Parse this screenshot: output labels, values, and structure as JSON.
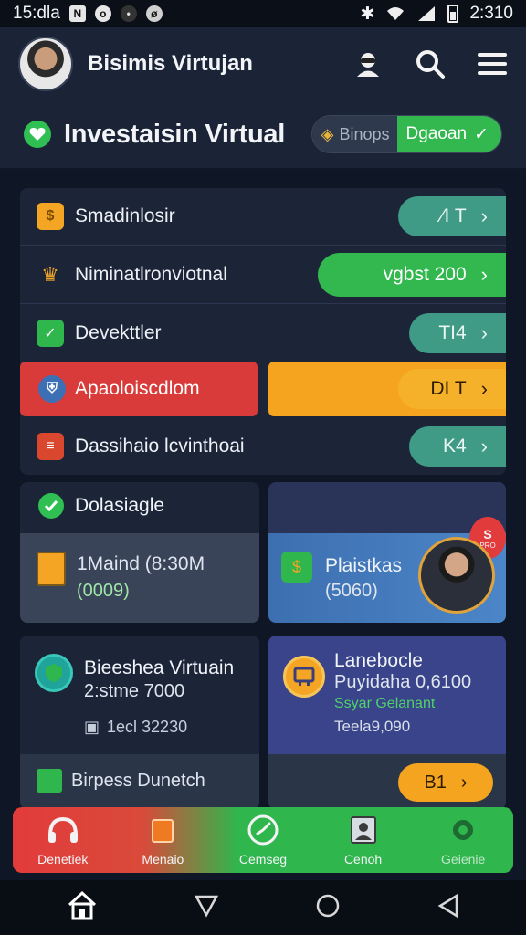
{
  "status_bar": {
    "time_left": "15:dla",
    "time_right": "2:310"
  },
  "header": {
    "title": "Bisimis Virtujan"
  },
  "section": {
    "title": "Investaisin Virtual",
    "toggle_inactive": "Binops",
    "toggle_active": "Dgaoan"
  },
  "list": {
    "items": [
      {
        "label": "Smadinlosir",
        "value": "⁄I T"
      },
      {
        "label": "Niminatlronviotnal",
        "value": "vgbst 200"
      },
      {
        "label": "Devekttler",
        "value": "TI4"
      },
      {
        "label": "Apaoloiscdlom",
        "value": "DI T"
      },
      {
        "label": "Dassihaio lcvinthoai",
        "value": "K4"
      }
    ]
  },
  "cards": {
    "card1": {
      "title": "Dolasiagle",
      "subtitle": "1Maind (8:30M",
      "value": "(0009)"
    },
    "card2": {
      "badge": "S",
      "badge_sub": "PRO",
      "title": "Plaistkas",
      "value": "(5060)"
    },
    "card3": {
      "title": "Bieeshea Virtuain",
      "subtitle": "2:stme 7000",
      "detail": "1ecl 32230",
      "footer": "Birpess Dunetch"
    },
    "card4": {
      "title": "Lanebocle",
      "subtitle": "Puyidaha 0,6100",
      "note": "Ssyar Gelanant",
      "detail": "Teela9,090",
      "button": "B1"
    }
  },
  "bottom_nav": {
    "items": [
      {
        "label": "Denetiek"
      },
      {
        "label": "Menaio"
      },
      {
        "label": "Cemseg"
      },
      {
        "label": "Cenoh"
      },
      {
        "label": "Geienie"
      }
    ]
  },
  "colors": {
    "background": "#0f1626",
    "panel": "#1c2538",
    "teal_pill": "#3f9a86",
    "green": "#2fb64d",
    "orange": "#f4a41f",
    "red": "#d93a3a",
    "blue_card": "#3a5a9e"
  },
  "icons": {
    "header": [
      "user-badge-icon",
      "search-icon",
      "menu-icon"
    ],
    "system": [
      "home-icon",
      "back-triangle-icon",
      "circle-home-icon",
      "recent-triangle-icon"
    ]
  }
}
